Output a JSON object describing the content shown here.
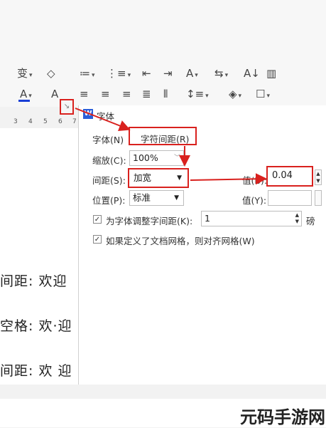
{
  "toolbar": {
    "row1": [
      {
        "icon": "text-effect-icon",
        "glyph": "变"
      },
      {
        "icon": "clear-format-icon",
        "glyph": "◇"
      },
      {
        "icon": "bullet-list-icon",
        "glyph": "≔"
      },
      {
        "icon": "numbered-list-icon",
        "glyph": "⋮≡"
      },
      {
        "icon": "decrease-indent-icon",
        "glyph": "⇤"
      },
      {
        "icon": "increase-indent-icon",
        "glyph": "⇥"
      },
      {
        "icon": "chinese-layout-icon",
        "glyph": "A"
      },
      {
        "icon": "text-direction-icon",
        "glyph": "⇆"
      },
      {
        "icon": "sort-icon",
        "glyph": "A↓"
      },
      {
        "icon": "table-icon",
        "glyph": "▥"
      }
    ],
    "row2": [
      {
        "icon": "font-color-icon",
        "glyph": "A"
      },
      {
        "icon": "char-shading-icon",
        "glyph": "A"
      },
      {
        "icon": "align-left-icon",
        "glyph": "≡"
      },
      {
        "icon": "align-center-icon",
        "glyph": "≡"
      },
      {
        "icon": "align-right-icon",
        "glyph": "≡"
      },
      {
        "icon": "justify-icon",
        "glyph": "≣"
      },
      {
        "icon": "distributed-icon",
        "glyph": "⫴"
      },
      {
        "icon": "line-spacing-icon",
        "glyph": "↕≡"
      },
      {
        "icon": "fill-icon",
        "glyph": "◈"
      },
      {
        "icon": "border-icon",
        "glyph": "☐"
      }
    ],
    "font_color": "#1a3fd6",
    "launcher_glyph": "↘"
  },
  "ruler": [
    "3",
    "4",
    "5",
    "6",
    "7"
  ],
  "document": {
    "lines": [
      "间距: 欢迎",
      "空格: 欢·迎",
      "间距: 欢 迎"
    ]
  },
  "dialog": {
    "app_icon": "W",
    "title": "字体",
    "tab_font": "字体(N)",
    "tab_spacing": "字符间距(R)",
    "scale_label": "缩放(C):",
    "scale_value": "100%",
    "spacing_label": "间距(S):",
    "spacing_value": "加宽",
    "spacing_amount_label": "值(B):",
    "spacing_amount_value": "0.04",
    "position_label": "位置(P):",
    "position_value": "标准",
    "position_amount_label": "值(Y):",
    "position_amount_value": "",
    "kerning_label": "为字体调整字间距(K):",
    "kerning_value": "1",
    "kerning_unit": "磅",
    "grid_label": "如果定义了文档网格，则对齐网格(W)",
    "check_mark": "✓"
  },
  "watermark": {
    "text": "元码手游网"
  },
  "colors": {
    "highlight": "#d9211e",
    "accent": "#1a3fd6"
  }
}
